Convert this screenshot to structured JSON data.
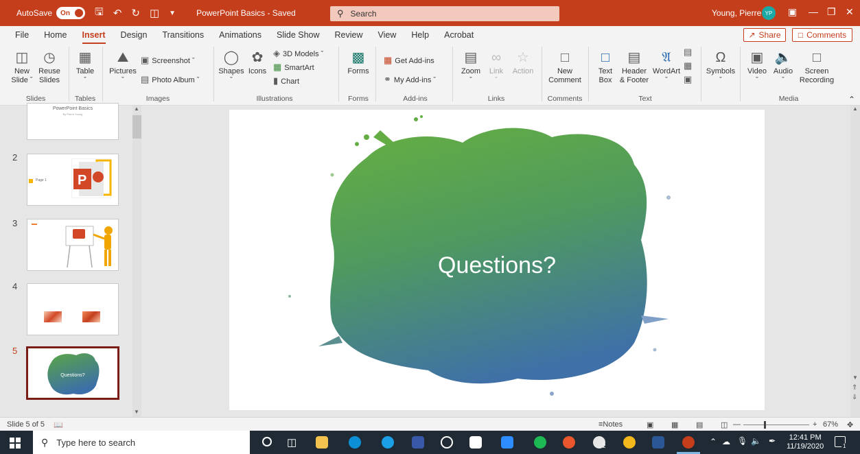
{
  "titlebar": {
    "autosave_label": "AutoSave",
    "autosave_state": "On",
    "doc_title": "PowerPoint Basics - Saved",
    "search_placeholder": "Search",
    "user_name": "Young, Pierre",
    "user_initials": "YP"
  },
  "tabs": [
    "File",
    "Home",
    "Insert",
    "Design",
    "Transitions",
    "Animations",
    "Slide Show",
    "Review",
    "View",
    "Help",
    "Acrobat"
  ],
  "active_tab": "Insert",
  "share_label": "Share",
  "comments_label": "Comments",
  "ribbon": {
    "new_slide": [
      "New",
      "Slide"
    ],
    "reuse_slides": [
      "Reuse",
      "Slides"
    ],
    "table": "Table",
    "pictures": "Pictures",
    "screenshot": "Screenshot",
    "photo_album": "Photo Album",
    "shapes": "Shapes",
    "icons": "Icons",
    "models_3d": "3D Models",
    "smartart": "SmartArt",
    "chart": "Chart",
    "forms": "Forms",
    "get_addins": "Get Add-ins",
    "my_addins": "My Add-ins",
    "zoom": "Zoom",
    "link": "Link",
    "action": "Action",
    "new_comment": [
      "New",
      "Comment"
    ],
    "text_box": [
      "Text",
      "Box"
    ],
    "header_footer": [
      "Header",
      "& Footer"
    ],
    "wordart": "WordArt",
    "symbols": "Symbols",
    "video": "Video",
    "audio": "Audio",
    "screen_recording": [
      "Screen",
      "Recording"
    ],
    "groups": {
      "slides": "Slides",
      "tables": "Tables",
      "images": "Images",
      "illustrations": "Illustrations",
      "forms": "Forms",
      "addins": "Add-ins",
      "links": "Links",
      "comments": "Comments",
      "text": "Text",
      "media": "Media"
    }
  },
  "thumbnails": {
    "slide1_title": "PowerPoint Basics",
    "slide1_sub": "By Pierre Young",
    "slide2_label": "Page 1",
    "slide5_text": "Questions?",
    "numbers": [
      "2",
      "3",
      "4",
      "5"
    ]
  },
  "slide": {
    "title": "Questions?"
  },
  "statusbar": {
    "slide_counter": "Slide 5 of 5",
    "notes": "Notes",
    "zoom_level": "67%",
    "zoom_fraction": 0.67
  },
  "taskbar": {
    "search_placeholder": "Type here to search",
    "time": "12:41 PM",
    "date": "11/19/2020",
    "notification_count": "1",
    "xbox_badge": "2"
  }
}
